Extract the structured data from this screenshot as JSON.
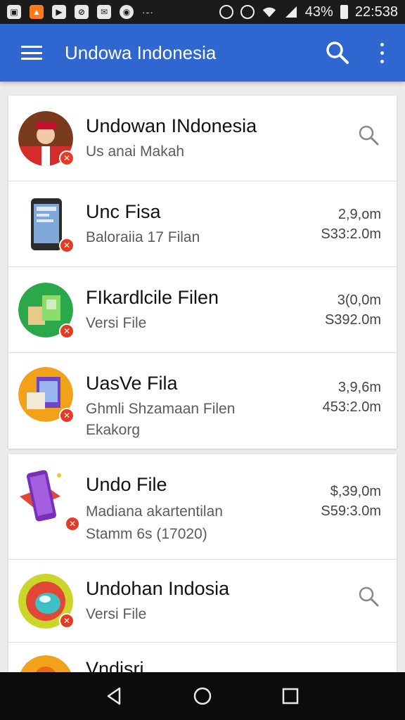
{
  "status_bar": {
    "left_icons": [
      "image-icon",
      "app-icon",
      "youtube-icon",
      "gallery-icon",
      "mail-icon",
      "messenger-icon"
    ],
    "dots": "·-·",
    "battery": "43%",
    "time": "22:538"
  },
  "app_bar": {
    "title": "Undowa Indonesia",
    "color": "#2f66cf"
  },
  "list": [
    {
      "title": "Undowan INdonesia",
      "subtitle": "Us anai Makah",
      "subtitle2": "",
      "meta1": "",
      "meta2": "",
      "trailing_icon": "search-icon",
      "avatar_icon": "person-avatar"
    },
    {
      "title": "Unc Fisa",
      "subtitle": "Baloraiia 17 Filan",
      "subtitle2": "",
      "meta1": "2,9,om",
      "meta2": "S33:2.0m",
      "trailing_icon": "",
      "avatar_icon": "phone-avatar"
    },
    {
      "title": "FIkardlcile Filen",
      "subtitle": "Versi File",
      "subtitle2": "",
      "meta1": "3(0,0m",
      "meta2": "S392.0m",
      "trailing_icon": "",
      "avatar_icon": "package-avatar"
    },
    {
      "title": "UasVe Fila",
      "subtitle": "Ghmli Shzamaan Filen",
      "subtitle2": "Ekakorg",
      "meta1": "3,9,6m",
      "meta2": "453:2.0m",
      "trailing_icon": "",
      "avatar_icon": "folder-avatar"
    },
    {
      "title": "Undo File",
      "subtitle": "Madiana akartentilan",
      "subtitle2": "Stamm 6s (17020)",
      "meta1": "$,39,0m",
      "meta2": "S59:3.0m",
      "trailing_icon": "",
      "avatar_icon": "phone-purple-avatar"
    },
    {
      "title": "Undohan Indosia",
      "subtitle": "Versi File",
      "subtitle2": "",
      "meta1": "",
      "meta2": "",
      "trailing_icon": "search-icon",
      "avatar_icon": "ball-avatar"
    },
    {
      "title": "Vndisri",
      "subtitle": "",
      "subtitle2": "",
      "meta1": "",
      "meta2": "",
      "trailing_icon": "",
      "avatar_icon": "orange-avatar"
    }
  ],
  "nav_bar": {
    "buttons": [
      "back-icon",
      "home-icon",
      "recents-icon"
    ]
  }
}
